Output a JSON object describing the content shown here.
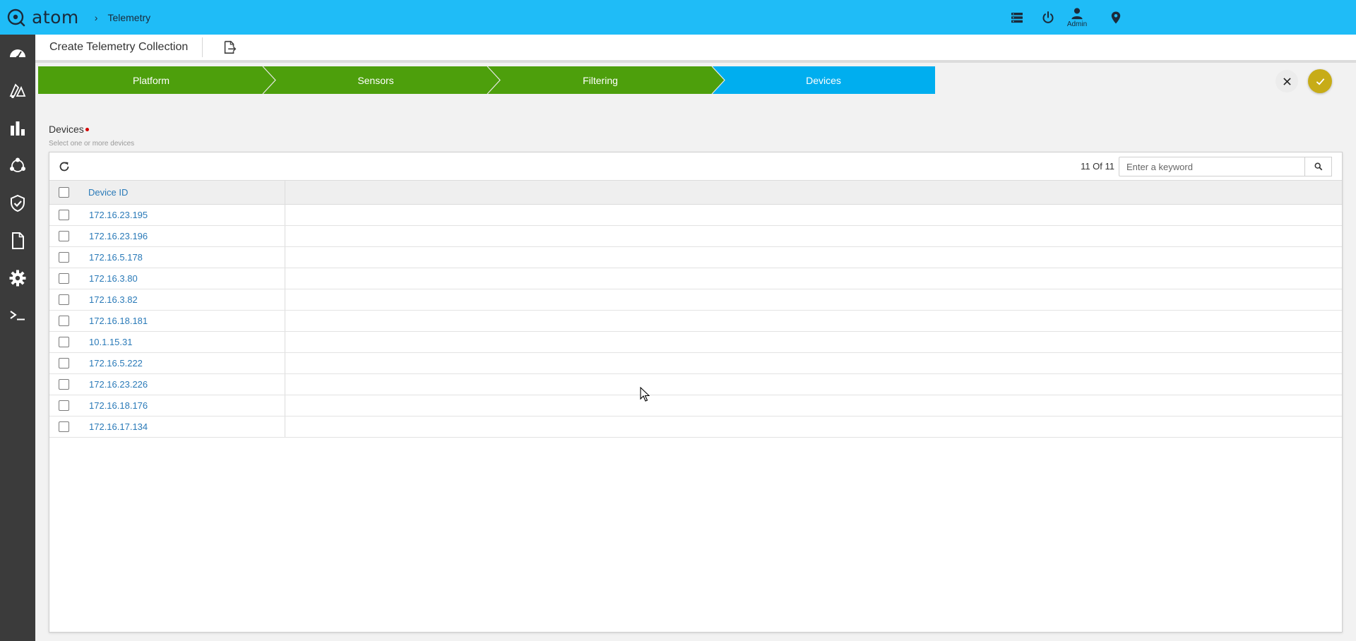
{
  "app": {
    "name": "atom",
    "breadcrumb_sep": "›",
    "breadcrumb": "Telemetry"
  },
  "topbar": {
    "user_label": "Admin",
    "icons": [
      "list-icon",
      "power-icon",
      "user-icon",
      "location-pin-icon"
    ]
  },
  "sidebar": {
    "items": [
      "dashboard-icon",
      "inventory-icon",
      "analytics-icon",
      "topology-icon",
      "compliance-icon",
      "document-icon",
      "settings-icon",
      "terminal-icon"
    ]
  },
  "header": {
    "title": "Create Telemetry Collection"
  },
  "steps": [
    {
      "label": "Platform",
      "status": "completed"
    },
    {
      "label": "Sensors",
      "status": "completed"
    },
    {
      "label": "Filtering",
      "status": "completed"
    },
    {
      "label": "Devices",
      "status": "active"
    }
  ],
  "colors": {
    "topbar": "#1fbcf7",
    "step_completed": "#4d9f0c",
    "step_active": "#00aeef",
    "confirm": "#c7ac17",
    "link": "#2a7ab8",
    "sidebar": "#3b3b3b"
  },
  "devices": {
    "label": "Devices",
    "hint": "Select one or more devices",
    "count_text": "11 Of 11",
    "search_placeholder": "Enter a keyword",
    "column_header": "Device ID",
    "rows": [
      "172.16.23.195",
      "172.16.23.196",
      "172.16.5.178",
      "172.16.3.80",
      "172.16.3.82",
      "172.16.18.181",
      "10.1.15.31",
      "172.16.5.222",
      "172.16.23.226",
      "172.16.18.176",
      "172.16.17.134"
    ]
  }
}
